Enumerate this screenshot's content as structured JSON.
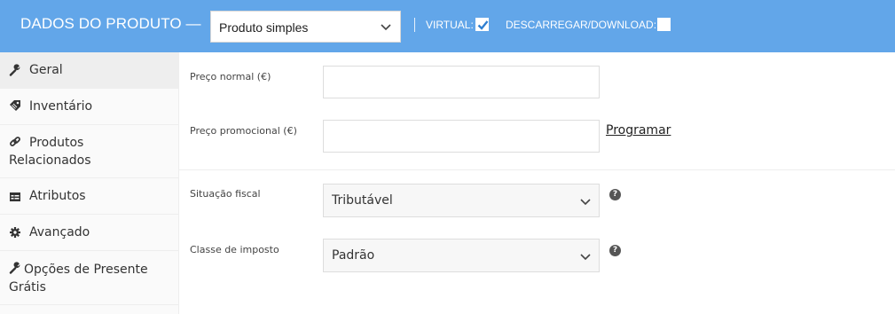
{
  "header": {
    "title": "DADOS DO PRODUTO —",
    "product_type": "Produto simples",
    "virtual_label": "VIRTUAL:",
    "virtual_checked": true,
    "download_label": "DESCARREGAR/DOWNLOAD:",
    "download_checked": false
  },
  "sidebar": {
    "items": [
      {
        "label": "Geral",
        "icon": "wrench-icon",
        "active": true
      },
      {
        "label": "Inventário",
        "icon": "tag-icon"
      },
      {
        "label": "Produtos",
        "label2": "Relacionados",
        "icon": "link-icon"
      },
      {
        "label": "Atributos",
        "icon": "table-icon"
      },
      {
        "label": "Avançado",
        "icon": "gear-icon"
      },
      {
        "label": "Opções de Presente",
        "label2": "Grátis",
        "icon": "wrench-icon"
      }
    ]
  },
  "pricing": {
    "regular_price_label": "Preço normal (€)",
    "regular_price_value": "",
    "sale_price_label": "Preço promocional (€)",
    "sale_price_value": "",
    "schedule_link": "Programar"
  },
  "tax": {
    "status_label": "Situação fiscal",
    "status_value": "Tributável",
    "class_label": "Classe de imposto",
    "class_value": "Padrão",
    "help_glyph": "?"
  },
  "colors": {
    "header_bg": "#62a6e9",
    "checkbox_check": "#2f7fd1"
  }
}
